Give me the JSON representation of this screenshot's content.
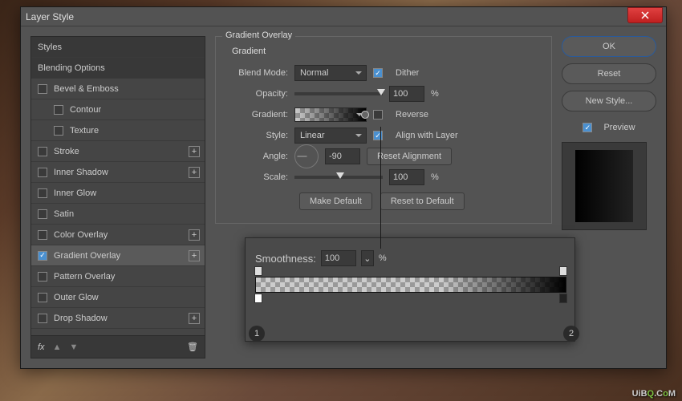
{
  "dialog": {
    "title": "Layer Style"
  },
  "sidebar": {
    "header": "Styles",
    "blending": "Blending Options",
    "items": [
      {
        "label": "Bevel & Emboss",
        "checked": false
      },
      {
        "label": "Contour",
        "checked": false,
        "sub": true
      },
      {
        "label": "Texture",
        "checked": false,
        "sub": true
      },
      {
        "label": "Stroke",
        "checked": false,
        "plus": true
      },
      {
        "label": "Inner Shadow",
        "checked": false,
        "plus": true
      },
      {
        "label": "Inner Glow",
        "checked": false
      },
      {
        "label": "Satin",
        "checked": false
      },
      {
        "label": "Color Overlay",
        "checked": false,
        "plus": true
      },
      {
        "label": "Gradient Overlay",
        "checked": true,
        "plus": true,
        "active": true
      },
      {
        "label": "Pattern Overlay",
        "checked": false
      },
      {
        "label": "Outer Glow",
        "checked": false
      },
      {
        "label": "Drop Shadow",
        "checked": false,
        "plus": true
      }
    ],
    "fx_label": "fx"
  },
  "overlay": {
    "group_title": "Gradient Overlay",
    "sub_title": "Gradient",
    "blend_mode": {
      "label": "Blend Mode:",
      "value": "Normal"
    },
    "dither": {
      "label": "Dither",
      "checked": true
    },
    "opacity": {
      "label": "Opacity:",
      "value": "100",
      "unit": "%"
    },
    "gradient": {
      "label": "Gradient:"
    },
    "reverse": {
      "label": "Reverse",
      "checked": false
    },
    "style": {
      "label": "Style:",
      "value": "Linear"
    },
    "align": {
      "label": "Align with Layer",
      "checked": true
    },
    "angle": {
      "label": "Angle:",
      "value": "-90"
    },
    "reset_align": "Reset Alignment",
    "scale": {
      "label": "Scale:",
      "value": "100",
      "unit": "%"
    },
    "make_default": "Make Default",
    "reset_default": "Reset to Default"
  },
  "popup": {
    "smoothness_label": "Smoothness:",
    "smoothness_value": "100",
    "smoothness_unit": "%"
  },
  "badges": {
    "one": "1",
    "two": "2"
  },
  "right": {
    "ok": "OK",
    "reset": "Reset",
    "new_style": "New Style...",
    "preview": "Preview"
  },
  "watermark": {
    "a": "UiB",
    "b": "Q",
    "c": ".C",
    "d": "o",
    "e": "M"
  }
}
